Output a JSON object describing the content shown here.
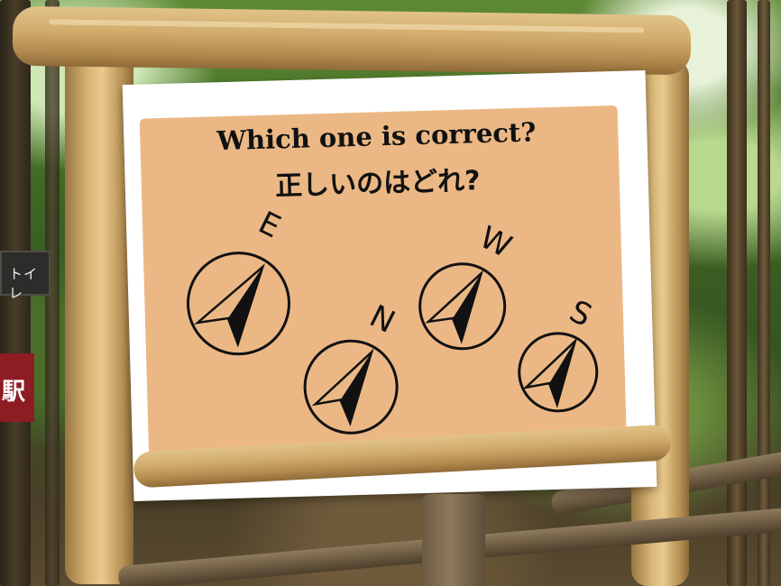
{
  "sign": {
    "title_en": "Which one is correct?",
    "title_ja": "正しいのはどれ?"
  },
  "compasses": [
    {
      "id": "compass-1",
      "letter": "E"
    },
    {
      "id": "compass-2",
      "letter": "N"
    },
    {
      "id": "compass-3",
      "letter": "W"
    },
    {
      "id": "compass-4",
      "letter": "S"
    }
  ],
  "background_signs": {
    "dark_sign_text": "トイレ",
    "red_sign_text": "駅"
  },
  "colors": {
    "panel": "#ebb885",
    "board": "#ffffff",
    "ink": "#111111"
  }
}
